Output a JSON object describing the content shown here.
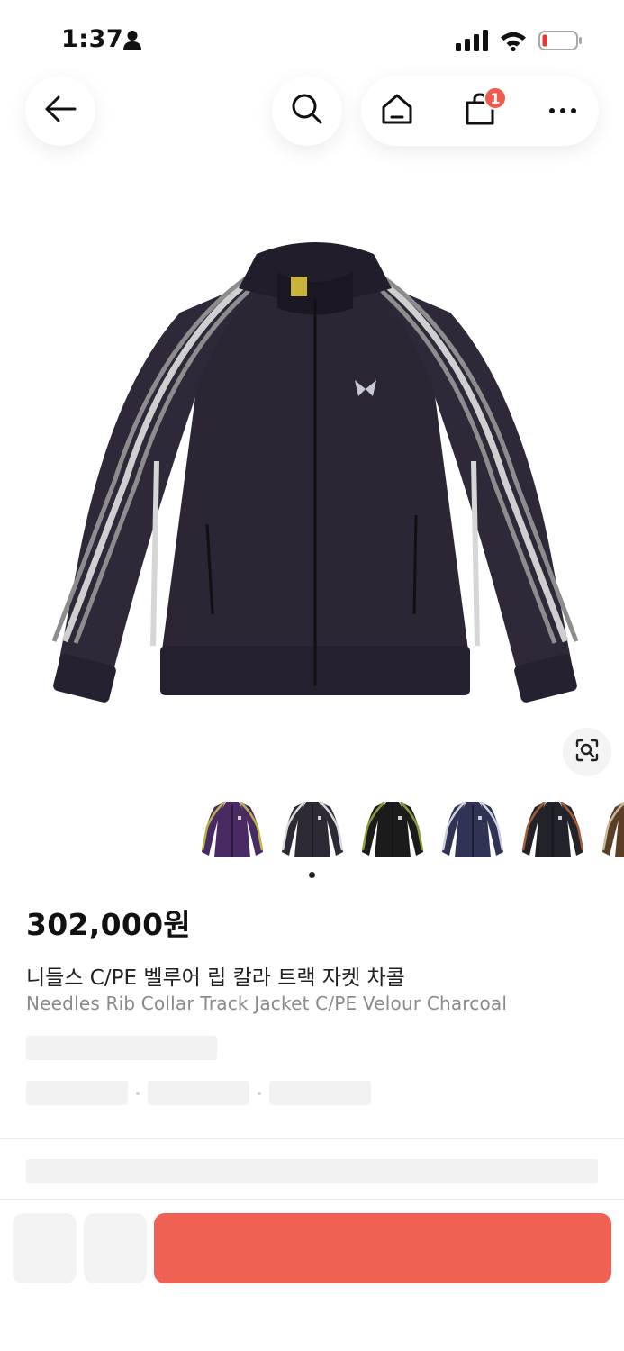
{
  "status_bar": {
    "time": "1:37",
    "icons": [
      "person-icon",
      "cellular-signal-icon",
      "wifi-icon",
      "battery-low-icon"
    ]
  },
  "nav": {
    "icons": [
      "back-arrow-icon",
      "search-icon",
      "home-icon",
      "shopping-bag-icon",
      "more-dots-icon"
    ],
    "cart_count": "1"
  },
  "product": {
    "price": "302,000원",
    "title_ko": "니들스 C/PE 벨루어 립 칼라 트랙 자켓 차콜",
    "title_en": "Needles Rib Collar Track Jacket C/PE Velour Charcoal",
    "image_icon": "track-jacket-image",
    "lens_icon": "lens-search-icon"
  },
  "gallery": {
    "thumbnails": [
      {
        "body_color": "#4a2a63",
        "stripe_color": "#b8b24a"
      },
      {
        "body_color": "#2d2a36",
        "stripe_color": "#d9d9d9"
      },
      {
        "body_color": "#1b1b1b",
        "stripe_color": "#8f9a3c"
      },
      {
        "body_color": "#2f3354",
        "stripe_color": "#cfcfe0"
      },
      {
        "body_color": "#22222a",
        "stripe_color": "#a65a35"
      },
      {
        "body_color": "#5b3e26",
        "stripe_color": "#c9b89a"
      }
    ],
    "active_index": 0
  },
  "colors": {
    "accent": "#ef6152",
    "badge": "#ef5b4c",
    "skeleton": "#f2f2f2"
  }
}
